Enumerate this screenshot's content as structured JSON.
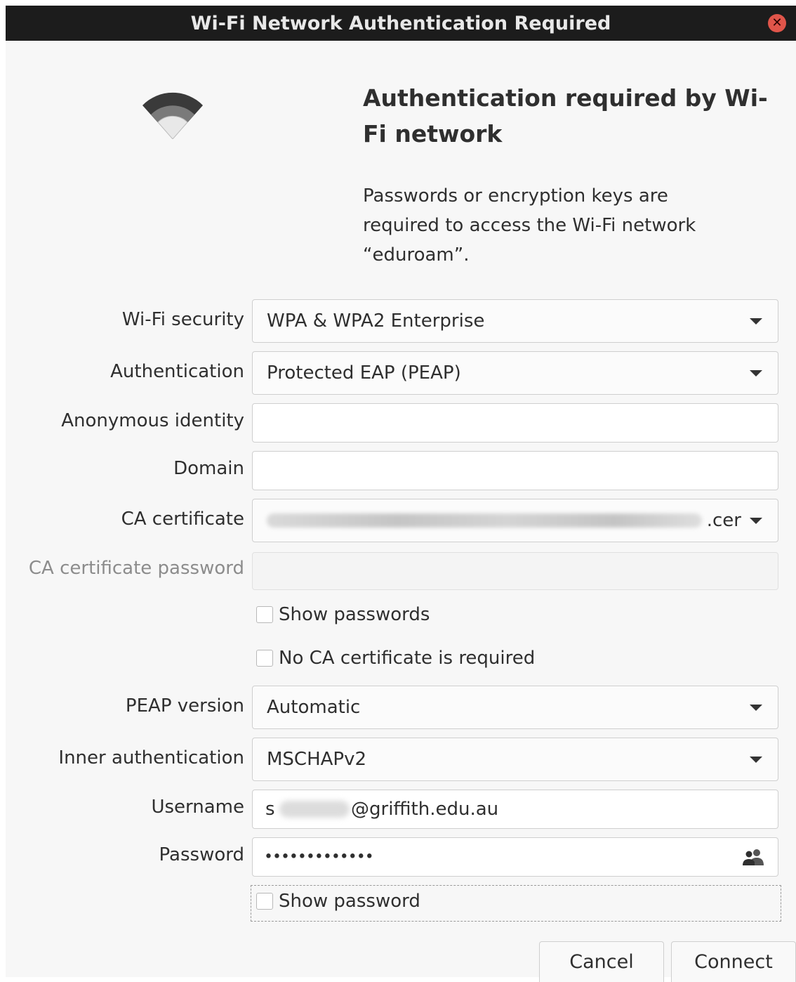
{
  "window": {
    "title": "Wi-Fi Network Authentication Required"
  },
  "header": {
    "heading": "Authentication required by Wi-Fi network",
    "description": "Passwords or encryption keys are required to access the Wi-Fi network “eduroam”."
  },
  "form": {
    "wifi_security": {
      "label": "Wi-Fi security",
      "value": "WPA & WPA2 Enterprise"
    },
    "authentication": {
      "label": "Authentication",
      "value": "Protected EAP (PEAP)"
    },
    "anonymous_identity": {
      "label": "Anonymous identity",
      "value": ""
    },
    "domain": {
      "label": "Domain",
      "value": ""
    },
    "ca_certificate": {
      "label": "CA certificate",
      "value_suffix": ".cer"
    },
    "ca_certificate_password": {
      "label": "CA certificate password",
      "value": ""
    },
    "show_passwords": {
      "label": "Show passwords",
      "checked": false
    },
    "no_ca_required": {
      "label": "No CA certificate is required",
      "checked": false
    },
    "peap_version": {
      "label": "PEAP version",
      "value": "Automatic"
    },
    "inner_authentication": {
      "label": "Inner authentication",
      "value": "MSCHAPv2"
    },
    "username": {
      "label": "Username",
      "prefix": "s",
      "suffix": "@griffith.edu.au"
    },
    "password": {
      "label": "Password",
      "masked": "•••••••••••••"
    },
    "show_password": {
      "label": "Show password",
      "checked": false
    }
  },
  "buttons": {
    "cancel": "Cancel",
    "connect": "Connect"
  },
  "icons": {
    "close": "close-icon",
    "wifi": "wifi-icon",
    "dropdown": "chevron-down-icon",
    "user_selector": "people-icon"
  },
  "colors": {
    "titlebar": "#1c1c1c",
    "close": "#e0554a",
    "dialog_bg": "#f7f7f7"
  }
}
